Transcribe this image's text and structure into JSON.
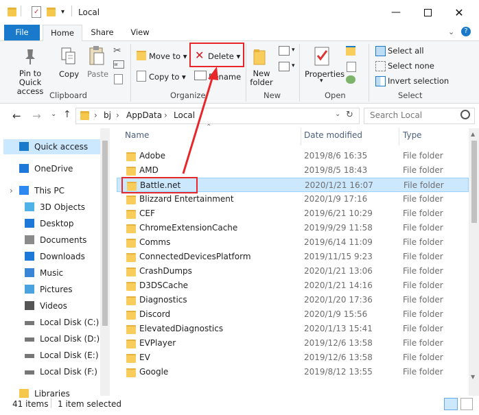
{
  "window": {
    "title": "Local"
  },
  "tabs": [
    {
      "label": "File"
    },
    {
      "label": "Home"
    },
    {
      "label": "Share"
    },
    {
      "label": "View"
    }
  ],
  "ribbon": {
    "clipboard": {
      "pin_line1": "Pin to Quick",
      "pin_line2": "access",
      "copy": "Copy",
      "paste": "Paste",
      "group": "Clipboard"
    },
    "organize": {
      "move_to": "Move to",
      "copy_to": "Copy to",
      "delete": "Delete",
      "rename": "Rename",
      "group": "Organize"
    },
    "new": {
      "folder_line1": "New",
      "folder_line2": "folder",
      "group": "New"
    },
    "open": {
      "properties": "Properties",
      "group": "Open"
    },
    "select": {
      "select_all": "Select all",
      "select_none": "Select none",
      "invert": "Invert selection",
      "group": "Select"
    }
  },
  "address": {
    "crumbs": [
      "bj",
      "AppData",
      "Local"
    ],
    "search_placeholder": "Search Local"
  },
  "nav": [
    {
      "label": "Quick access",
      "icon": "star-icon"
    },
    {
      "label": "OneDrive",
      "icon": "cloud-icon"
    },
    {
      "label": "This PC",
      "icon": "computer-icon"
    },
    {
      "label": "3D Objects",
      "icon": "cube-icon"
    },
    {
      "label": "Desktop",
      "icon": "desktop-icon"
    },
    {
      "label": "Documents",
      "icon": "document-icon"
    },
    {
      "label": "Downloads",
      "icon": "download-icon"
    },
    {
      "label": "Music",
      "icon": "music-icon"
    },
    {
      "label": "Pictures",
      "icon": "picture-icon"
    },
    {
      "label": "Videos",
      "icon": "video-icon"
    },
    {
      "label": "Local Disk (C:)",
      "icon": "drive-icon"
    },
    {
      "label": "Local Disk (D:)",
      "icon": "drive-icon"
    },
    {
      "label": "Local Disk  (E:)",
      "icon": "drive-icon"
    },
    {
      "label": "Local Disk (F:)",
      "icon": "drive-icon"
    },
    {
      "label": "Libraries",
      "icon": "library-icon"
    }
  ],
  "columns": {
    "name": "Name",
    "date": "Date modified",
    "type": "Type"
  },
  "files": [
    {
      "name": "Adobe",
      "date": "2019/8/6 16:35",
      "type": "File folder"
    },
    {
      "name": "AMD",
      "date": "2019/8/5 18:43",
      "type": "File folder"
    },
    {
      "name": "Battle.net",
      "date": "2020/1/21 16:07",
      "type": "File folder"
    },
    {
      "name": "Blizzard Entertainment",
      "date": "2020/1/9 17:16",
      "type": "File folder"
    },
    {
      "name": "CEF",
      "date": "2019/6/21 10:29",
      "type": "File folder"
    },
    {
      "name": "ChromeExtensionCache",
      "date": "2019/9/29 11:58",
      "type": "File folder"
    },
    {
      "name": "Comms",
      "date": "2019/6/14 11:09",
      "type": "File folder"
    },
    {
      "name": "ConnectedDevicesPlatform",
      "date": "2019/11/15 9:23",
      "type": "File folder"
    },
    {
      "name": "CrashDumps",
      "date": "2020/1/21 13:06",
      "type": "File folder"
    },
    {
      "name": "D3DSCache",
      "date": "2020/1/21 14:16",
      "type": "File folder"
    },
    {
      "name": "Diagnostics",
      "date": "2020/1/20 17:36",
      "type": "File folder"
    },
    {
      "name": "Discord",
      "date": "2020/1/9 15:56",
      "type": "File folder"
    },
    {
      "name": "ElevatedDiagnostics",
      "date": "2020/1/13 15:41",
      "type": "File folder"
    },
    {
      "name": "EVPlayer",
      "date": "2019/12/6 13:58",
      "type": "File folder"
    },
    {
      "name": "EV",
      "date": "2019/12/6 13:58",
      "type": "File folder"
    },
    {
      "name": "Google",
      "date": "2019/8/12 13:55",
      "type": "File folder"
    }
  ],
  "status": {
    "count": "41 items",
    "selected": "1 item selected"
  },
  "colors": {
    "accent": "#1979ca",
    "selection": "#cce8ff",
    "highlight": "#e8262a"
  }
}
